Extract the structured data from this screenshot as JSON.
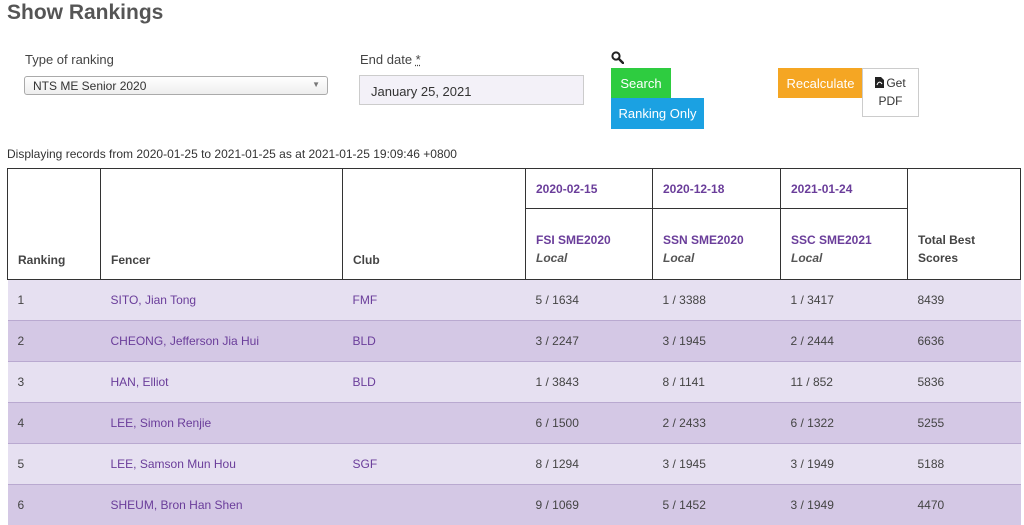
{
  "page": {
    "title": "Show Rankings"
  },
  "filters": {
    "type_label": "Type of ranking",
    "type_value": "NTS ME Senior 2020",
    "end_date_label": "End date",
    "end_date_required": "*",
    "end_date_value": "January 25, 2021"
  },
  "actions": {
    "search_label": "Search",
    "ranking_only_label": "Ranking Only",
    "recalculate_label": "Recalculate",
    "get_pdf_label_1": "Get",
    "get_pdf_label_2": "PDF"
  },
  "colors": {
    "search": "#2ecc40",
    "ranking_only": "#1ba1e2",
    "recalculate": "#f5a623",
    "link": "#6a3d9a"
  },
  "icons": {
    "search": "search-icon",
    "pdf": "pdf-file-icon",
    "dropdown": "chevron-down-icon"
  },
  "records_text": "Displaying records from 2020-01-25 to 2021-01-25 as at 2021-01-25 19:09:46 +0800",
  "table": {
    "headers": {
      "ranking": "Ranking",
      "fencer": "Fencer",
      "club": "Club",
      "total": "Total Best Scores"
    },
    "events": [
      {
        "date": "2020-02-15",
        "name": "FSI SME2020",
        "type": "Local"
      },
      {
        "date": "2020-12-18",
        "name": "SSN SME2020",
        "type": "Local"
      },
      {
        "date": "2021-01-24",
        "name": "SSC SME2021",
        "type": "Local"
      }
    ],
    "rows": [
      {
        "rank": "1",
        "fencer": "SITO, Jian Tong",
        "club": "FMF",
        "e1": "5 / 1634",
        "e2": "1 / 3388",
        "e3": "1 / 3417",
        "total": "8439"
      },
      {
        "rank": "2",
        "fencer": "CHEONG, Jefferson Jia Hui",
        "club": "BLD",
        "e1": "3 / 2247",
        "e2": "3 / 1945",
        "e3": "2 / 2444",
        "total": "6636"
      },
      {
        "rank": "3",
        "fencer": "HAN, Elliot",
        "club": "BLD",
        "e1": "1 / 3843",
        "e2": "8 / 1141",
        "e3": "11 / 852",
        "total": "5836"
      },
      {
        "rank": "4",
        "fencer": "LEE, Simon Renjie",
        "club": "",
        "e1": "6 / 1500",
        "e2": "2 / 2433",
        "e3": "6 / 1322",
        "total": "5255"
      },
      {
        "rank": "5",
        "fencer": "LEE, Samson Mun Hou",
        "club": "SGF",
        "e1": "8 / 1294",
        "e2": "3 / 1945",
        "e3": "3 / 1949",
        "total": "5188"
      },
      {
        "rank": "6",
        "fencer": "SHEUM, Bron Han Shen",
        "club": "",
        "e1": "9 / 1069",
        "e2": "5 / 1452",
        "e3": "3 / 1949",
        "total": "4470"
      }
    ]
  }
}
